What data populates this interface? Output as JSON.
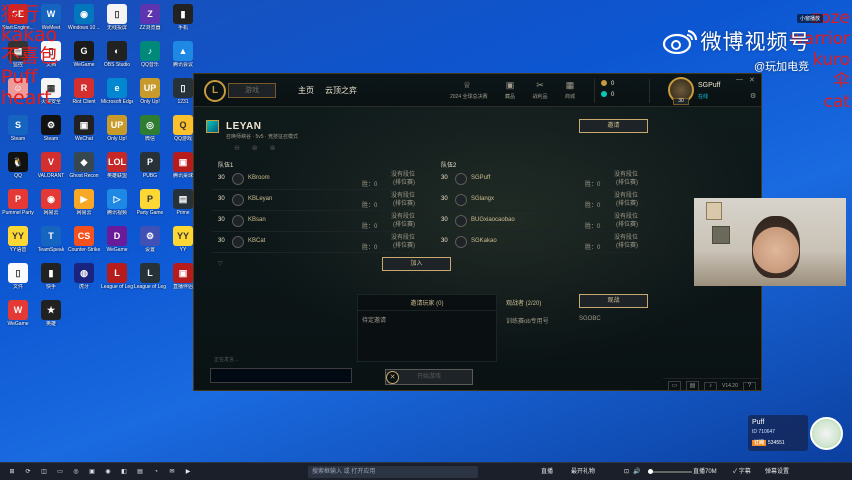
{
  "desktop": {
    "icons": [
      {
        "label": "Start:Engine...",
        "bg": "#c62828",
        "glyph": "SE"
      },
      {
        "label": "WeMeet",
        "bg": "#1565c0",
        "glyph": "W"
      },
      {
        "label": "Windows 10 ...",
        "bg": "#0277bd",
        "glyph": "◉"
      },
      {
        "label": "无线投屏",
        "bg": "#f4f4f4",
        "glyph": "▯"
      },
      {
        "label": "ZZ浏览器",
        "bg": "#5e35b1",
        "glyph": "Z"
      },
      {
        "label": "手机",
        "bg": "#222",
        "glyph": "▮"
      },
      {
        "label": "监控",
        "bg": "#333",
        "glyph": "▤"
      },
      {
        "label": "文档",
        "bg": "#fafafa",
        "glyph": "▯"
      },
      {
        "label": "WeGame",
        "bg": "#1a1a1a",
        "glyph": "G"
      },
      {
        "label": "OBS Studio",
        "bg": "#222",
        "glyph": "◐"
      },
      {
        "label": "QQ音乐",
        "bg": "#00897b",
        "glyph": "♪"
      },
      {
        "label": "腾讯会议",
        "bg": "#1e88e5",
        "glyph": "▲"
      },
      {
        "label": "",
        "bg": "#ef9a9a",
        "glyph": "☺"
      },
      {
        "label": "火绒安全",
        "bg": "#f5f5f5",
        "glyph": "▦"
      },
      {
        "label": "Riot Client",
        "bg": "#d32f2f",
        "glyph": "R"
      },
      {
        "label": "Microsoft Edge",
        "bg": "#0288d1",
        "glyph": "e"
      },
      {
        "label": "Only Up!",
        "bg": "#c79a2a",
        "glyph": "UP"
      },
      {
        "label": "1231",
        "bg": "#263238",
        "glyph": "▯"
      },
      {
        "label": "Steam",
        "bg": "#1565c0",
        "glyph": "S"
      },
      {
        "label": "Steam",
        "bg": "#111",
        "glyph": "⚙"
      },
      {
        "label": "WeChat",
        "bg": "#212121",
        "glyph": "▣"
      },
      {
        "label": "Only Up!",
        "bg": "#c79a2a",
        "glyph": "UP"
      },
      {
        "label": "微信",
        "bg": "#2e7d32",
        "glyph": "◎"
      },
      {
        "label": "QQ游戏",
        "bg": "#fbc02d",
        "glyph": "Q"
      },
      {
        "label": "QQ",
        "bg": "#111",
        "glyph": "🐧"
      },
      {
        "label": "VALORANT",
        "bg": "#d32f2f",
        "glyph": "V"
      },
      {
        "label": "Ghost Recon",
        "bg": "#37474f",
        "glyph": "◆"
      },
      {
        "label": "英雄联盟",
        "bg": "#c62828",
        "glyph": "LOL"
      },
      {
        "label": "PUBG",
        "bg": "#263238",
        "glyph": "P"
      },
      {
        "label": "腾讯桌球",
        "bg": "#b71c1c",
        "glyph": "▣"
      },
      {
        "label": "Pummel Party",
        "bg": "#e53935",
        "glyph": "P"
      },
      {
        "label": "网易云",
        "bg": "#e53935",
        "glyph": "◉"
      },
      {
        "label": "网易云",
        "bg": "#f9a825",
        "glyph": "▶"
      },
      {
        "label": "腾讯视频",
        "bg": "#1e88e5",
        "glyph": "▷"
      },
      {
        "label": "Party Game",
        "bg": "#fdd835",
        "glyph": "P"
      },
      {
        "label": "Prime",
        "bg": "#263238",
        "glyph": "▤"
      },
      {
        "label": "YY语音",
        "bg": "#fdd835",
        "glyph": "YY"
      },
      {
        "label": "TeamSpeak",
        "bg": "#1565c0",
        "glyph": "T"
      },
      {
        "label": "Counter-Strike",
        "bg": "#f4511e",
        "glyph": "CS"
      },
      {
        "label": "WeGame",
        "bg": "#6a1b9a",
        "glyph": "D"
      },
      {
        "label": "设置",
        "bg": "#3f51b5",
        "glyph": "⚙"
      },
      {
        "label": "YY",
        "bg": "#fdd835",
        "glyph": "YY"
      },
      {
        "label": "文件",
        "bg": "#fafafa",
        "glyph": "▯"
      },
      {
        "label": "快手",
        "bg": "#222",
        "glyph": "▮"
      },
      {
        "label": "虎牙",
        "bg": "#1a237e",
        "glyph": "◍"
      },
      {
        "label": "League of Legends",
        "bg": "#b71c1c",
        "glyph": "L"
      },
      {
        "label": "League of Legends",
        "bg": "#263238",
        "glyph": "L"
      },
      {
        "label": "直播伴侣",
        "bg": "#b71c1c",
        "glyph": "▣"
      },
      {
        "label": "WeGame",
        "bg": "#e53935",
        "glyph": "W"
      },
      {
        "label": "英雄",
        "bg": "#212121",
        "glyph": "★"
      }
    ]
  },
  "overlay": {
    "red_left": [
      "狼行",
      "kakao",
      "不喜包",
      "Puff",
      "heart"
    ],
    "red_right": [
      "zoze",
      "warrior",
      "kuro",
      "伞",
      "cat"
    ],
    "weibo_title": "微博视频号",
    "weibo_handle": "@玩加电竞",
    "mini_badge": "小窗播放"
  },
  "client": {
    "play_label": "游戏",
    "nav": [
      {
        "label": "主页"
      },
      {
        "label": "云顶之弈"
      }
    ],
    "nav_icons": [
      {
        "label": "2024 全球总决赛",
        "glyph": "♕"
      },
      {
        "label": "藏品",
        "glyph": "▣"
      },
      {
        "label": "战利品",
        "glyph": "✂"
      },
      {
        "label": "商城",
        "glyph": "▦"
      }
    ],
    "currency": {
      "rp": "0",
      "be": "0"
    },
    "profile": {
      "name": "SGPuff",
      "status": "在线",
      "level": "30"
    },
    "window_controls": [
      "—",
      "✕",
      "⚙"
    ],
    "lobby": {
      "title": "LEYAN",
      "subtitle": "召唤师峡谷 · 5v5 · 竞技征召模式",
      "ban_icons": "⊖ ⊛ ⊛",
      "invite_btn": "邀请",
      "team1_label": "队伍1",
      "team2_label": "队伍2",
      "team1": [
        {
          "level": "30",
          "name": "KBroom",
          "rank": "没有段位",
          "rank_sub": "(排位赛)",
          "wins": "胜：0"
        },
        {
          "level": "30",
          "name": "KBLeyan",
          "rank": "没有段位",
          "rank_sub": "(排位赛)",
          "wins": "胜：0"
        },
        {
          "level": "30",
          "name": "KBsan",
          "rank": "没有段位",
          "rank_sub": "(排位赛)",
          "wins": "胜：0"
        },
        {
          "level": "30",
          "name": "KBCat",
          "rank": "没有段位",
          "rank_sub": "(排位赛)",
          "wins": "胜：0"
        }
      ],
      "team2": [
        {
          "level": "30",
          "name": "SGPuff",
          "rank": "没有段位",
          "rank_sub": "(排位赛)",
          "wins": "胜：0"
        },
        {
          "level": "30",
          "name": "SGlangx",
          "rank": "没有段位",
          "rank_sub": "(排位赛)",
          "wins": "胜：0"
        },
        {
          "level": "30",
          "name": "BUGxiaocaobao",
          "rank": "没有段位",
          "rank_sub": "(排位赛)",
          "wins": "胜：0"
        },
        {
          "level": "30",
          "name": "SGKakao",
          "rank": "没有段位",
          "rank_sub": "(排位赛)",
          "wins": "胜：0"
        }
      ],
      "join_btn": "加入",
      "invited_header": "邀请玩家 (0)",
      "invited_text": "待定邀请",
      "spectators_title": "观战者 (2/20)",
      "spectate_btn": "观战",
      "spectators": [
        "训练赛ob专用号",
        "SGOBC"
      ],
      "chat_label": "正在发言...",
      "start_btn": "开始游戏",
      "version": "V14.20"
    }
  },
  "streamer": {
    "name": "Puff",
    "id": "ID 710647",
    "fans_badge": "订阅",
    "fans": "534551"
  },
  "taskbar": {
    "search_placeholder": "搜索框输入 或 打开应用",
    "items": [
      "⊞",
      "⟳",
      "◫",
      "▭",
      "◎",
      "▣",
      "◉",
      "◧",
      "▤",
      "◔",
      "✉",
      "▶"
    ],
    "right": [
      "直播",
      "最开礼物",
      "⊡",
      "🔊",
      "直播70M",
      "✓ 字幕",
      "弹幕设置"
    ]
  }
}
